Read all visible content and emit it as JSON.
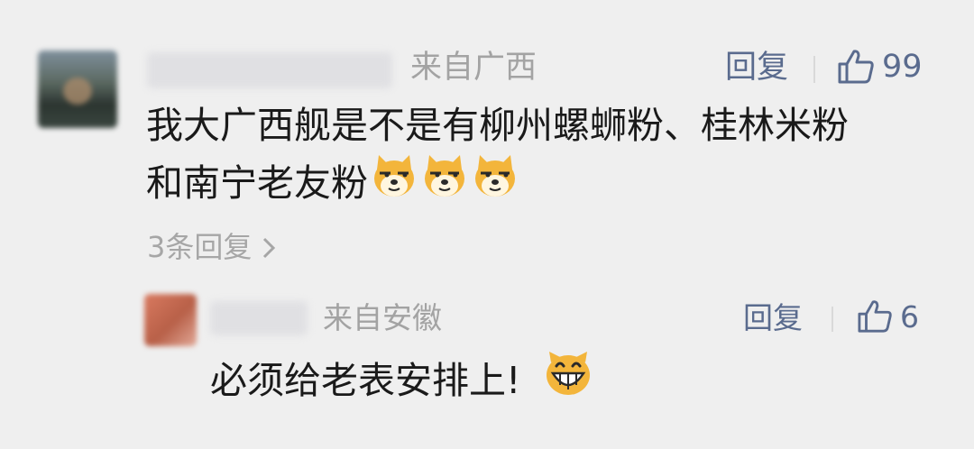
{
  "comment": {
    "location": "来自广西",
    "reply_label": "回复",
    "like_count": "99",
    "text_line1": "我大广西舰是不是有柳州螺蛳粉、桂林米粉",
    "text_line2": "和南宁老友粉",
    "emojis": [
      "doge-emoji",
      "doge-emoji",
      "doge-emoji"
    ],
    "more_replies": "3条回复"
  },
  "reply": {
    "location": "来自安徽",
    "reply_label": "回复",
    "like_count": "6",
    "text": "必须给老表安排上!",
    "emoji": "grin-emoji"
  }
}
